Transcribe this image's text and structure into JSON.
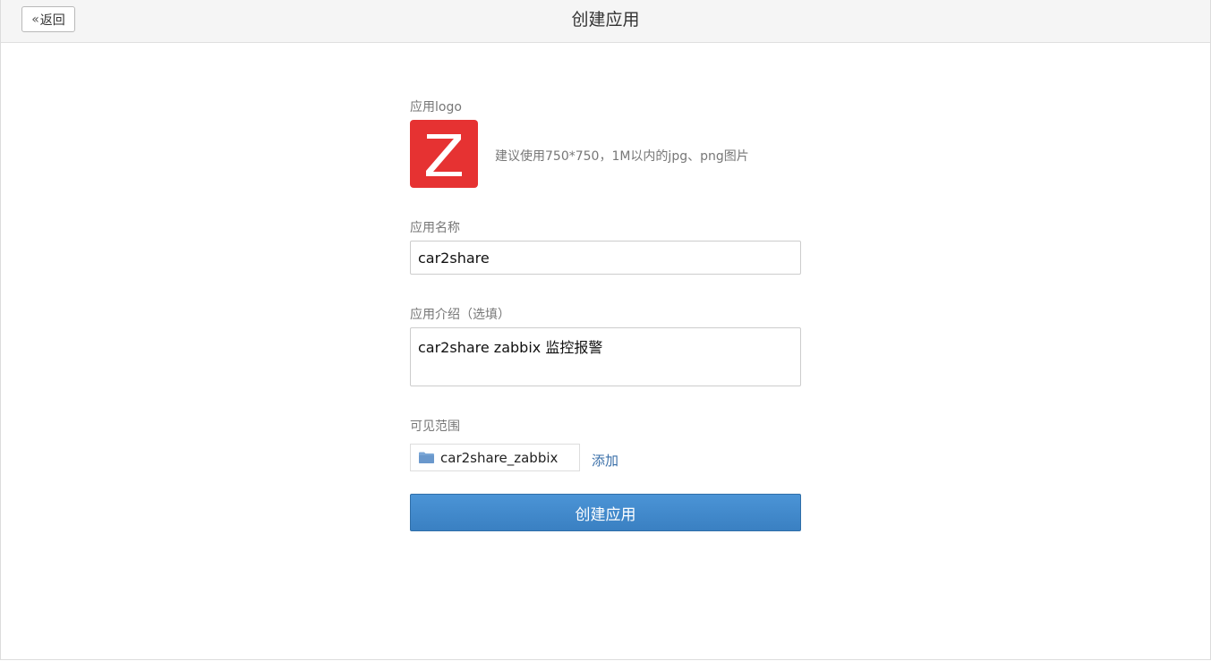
{
  "header": {
    "back_label": "返回",
    "title": "创建应用"
  },
  "form": {
    "logo": {
      "label": "应用logo",
      "letter": "Z",
      "color": "#e63232",
      "hint": "建议使用750*750，1M以内的jpg、png图片"
    },
    "name": {
      "label": "应用名称",
      "value": "car2share"
    },
    "description": {
      "label": "应用介绍（选填）",
      "value": "car2share zabbix 监控报警"
    },
    "scope": {
      "label": "可见范围",
      "icon": "folder-icon",
      "item": "car2share_zabbix",
      "add_label": "添加"
    },
    "submit_label": "创建应用"
  },
  "colors": {
    "primary": "#3a80c2",
    "link": "#3a6fa8",
    "logo_bg": "#e63232"
  }
}
